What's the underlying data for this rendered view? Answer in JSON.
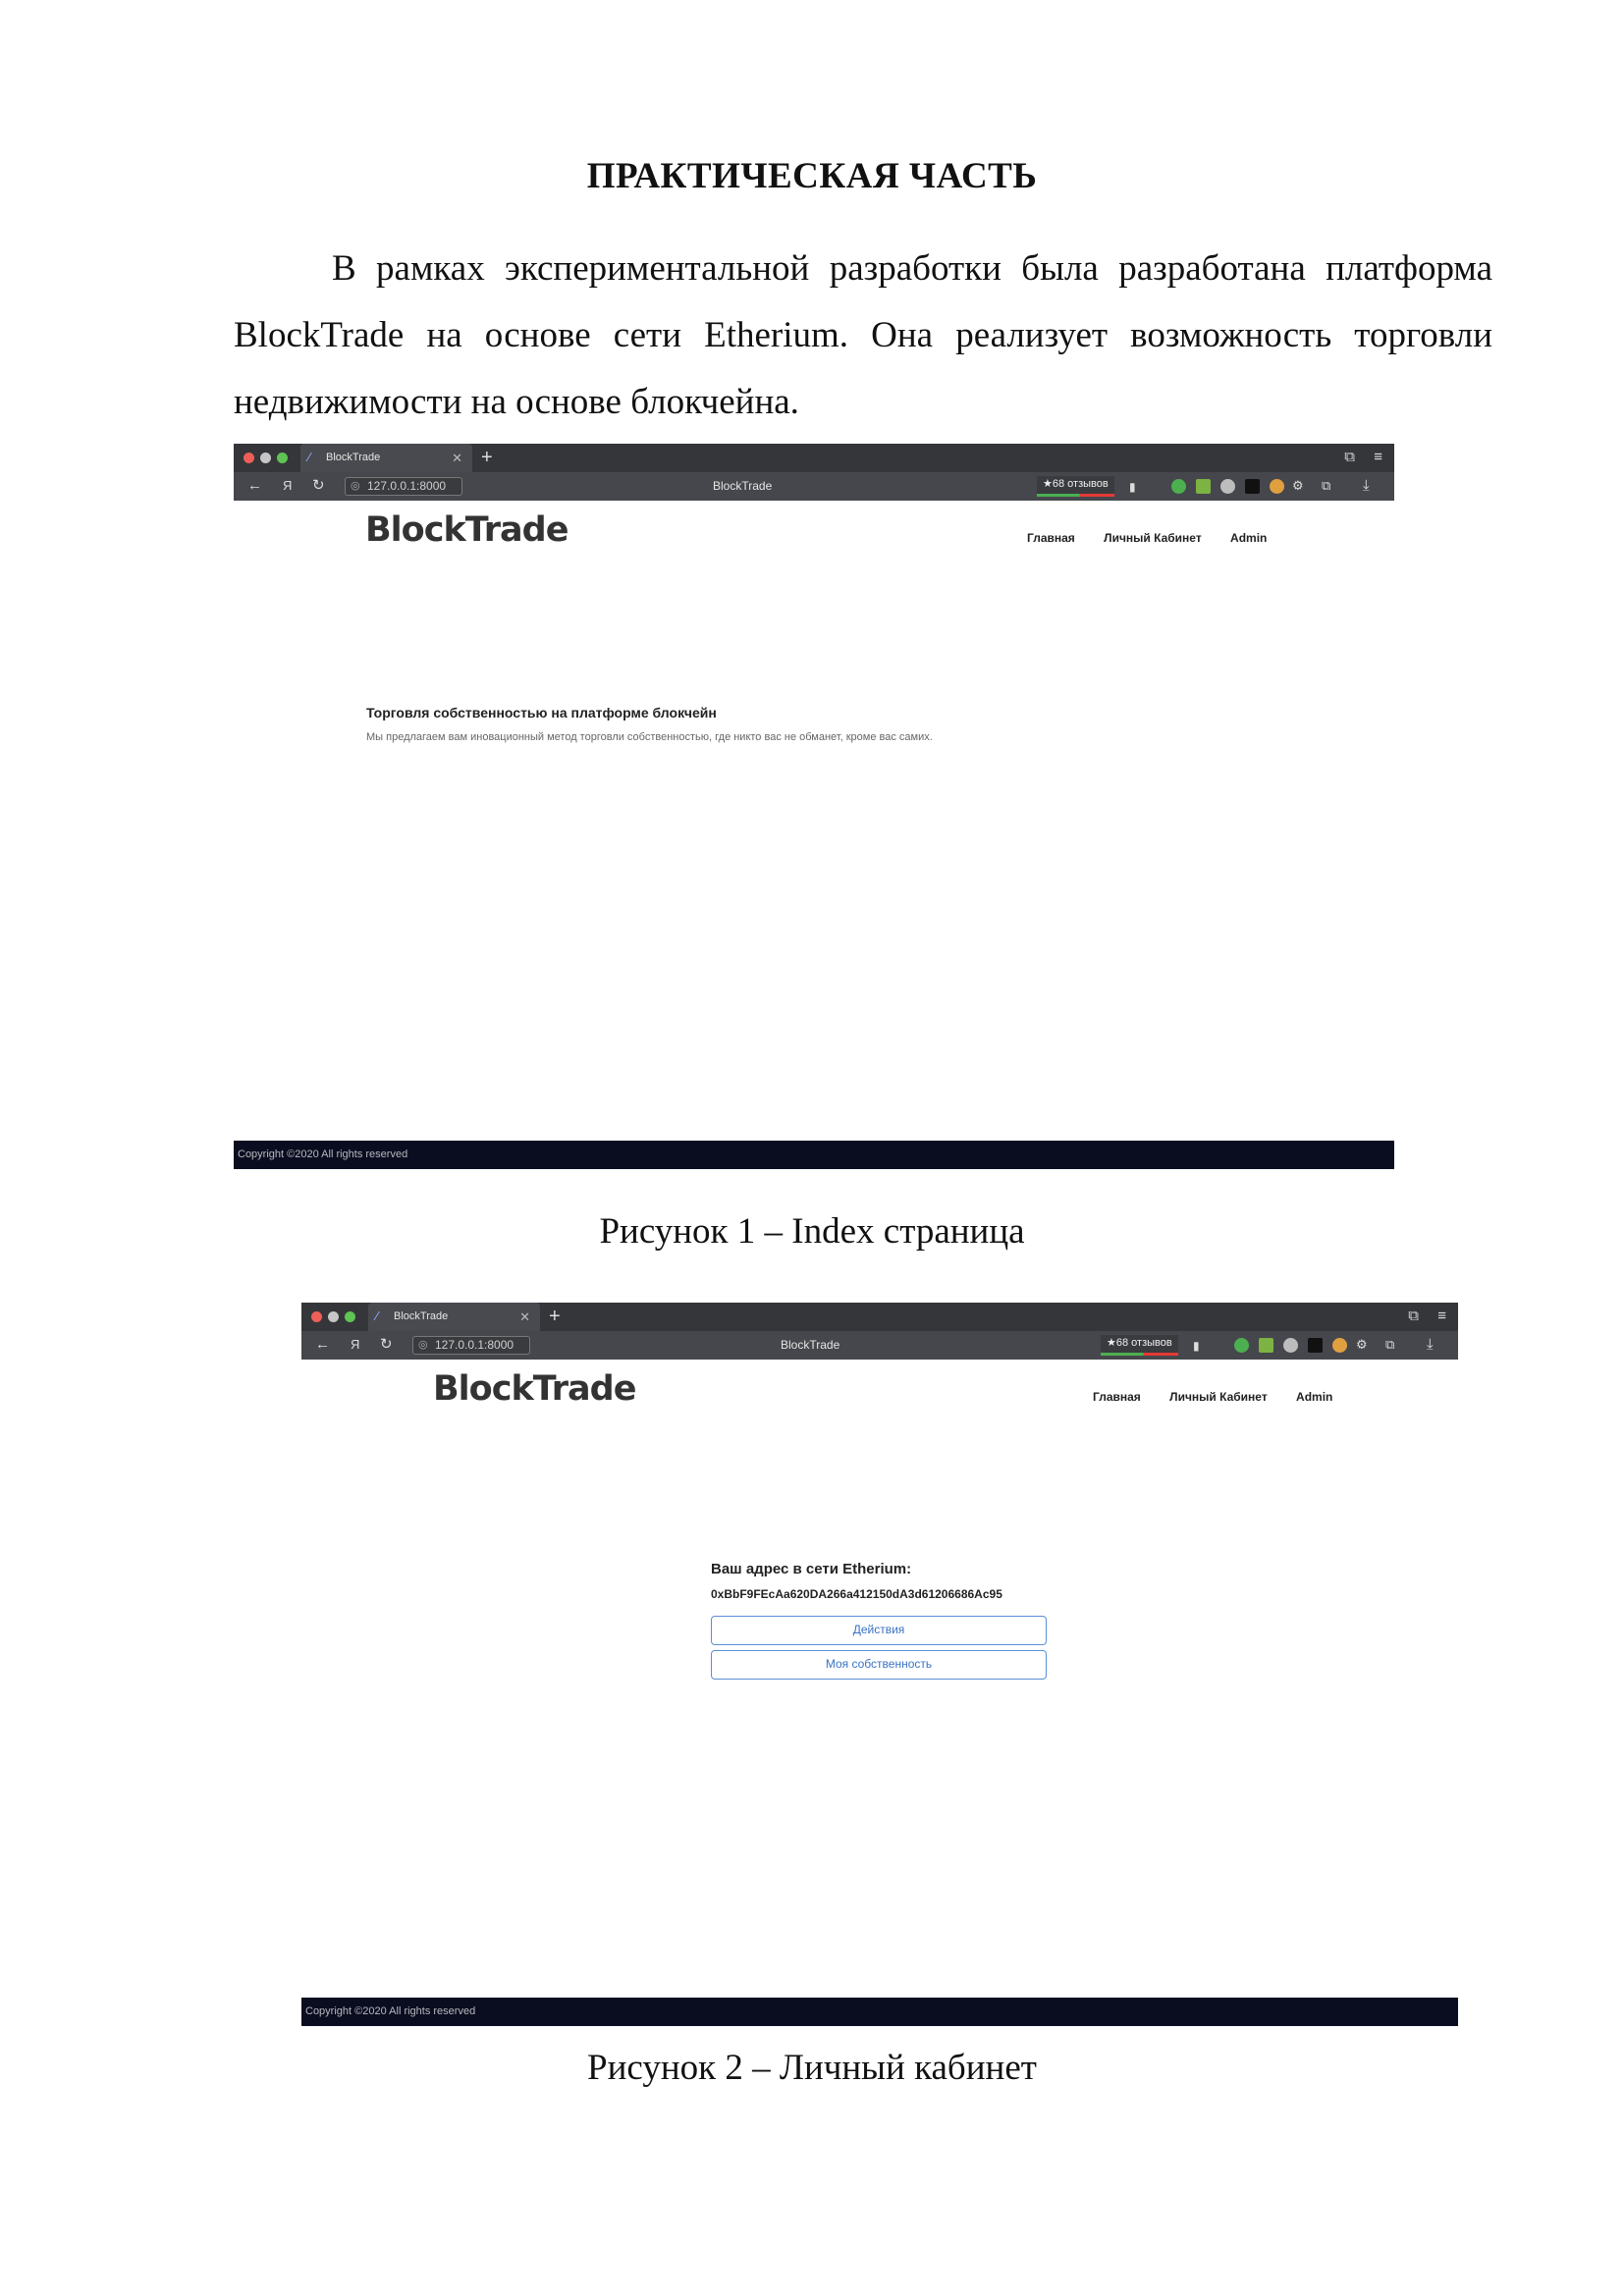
{
  "doc": {
    "title": "ПРАКТИЧЕСКАЯ ЧАСТЬ",
    "paragraph": "В рамках экспериментальной разработки была разработана платформа BlockTrade на основе сети Etherium. Она реализует возможность торговли недвижимости на основе блокчейна.",
    "caption1": "Рисунок 1 – Index страница",
    "caption2": "Рисунок 2 – Личный кабинет"
  },
  "browser": {
    "tab_title": "BlockTrade",
    "url": "127.0.0.1:8000",
    "page_title": "BlockTrade",
    "reviews": "★68 отзывов",
    "back_glyph": "←",
    "ya_glyph": "Я",
    "reload_glyph": "↻"
  },
  "site": {
    "logo": "BlockTrade",
    "nav": [
      "Главная",
      "Личный Кабинет",
      "Admin"
    ],
    "footer": "Copyright ©2020 All rights reserved"
  },
  "index_page": {
    "heading": "Торговля собственностью на платформе блокчейн",
    "text": "Мы предлагаем вам иновационный метод торговли собственностью, где никто вас не обманет, кроме вас самих."
  },
  "cabinet_page": {
    "address_label": "Ваш адрес в сети Etherium:",
    "address": "0xBbF9FEcAa620DA266a412150dA3d61206686Ac95",
    "buttons": [
      "Действия",
      "Моя собственность"
    ]
  },
  "colors": {
    "tabbar": "#35363a",
    "navbar": "#46474c",
    "footer": "#0a0d1f",
    "button_border": "#5b8fd6"
  },
  "icons": [
    "close-traffic-light",
    "minimize-traffic-light",
    "maximize-traffic-light",
    "back-arrow-icon",
    "yandex-icon",
    "reload-icon",
    "bookmark-icon",
    "shield-icon",
    "download-icon",
    "menu-icon"
  ]
}
